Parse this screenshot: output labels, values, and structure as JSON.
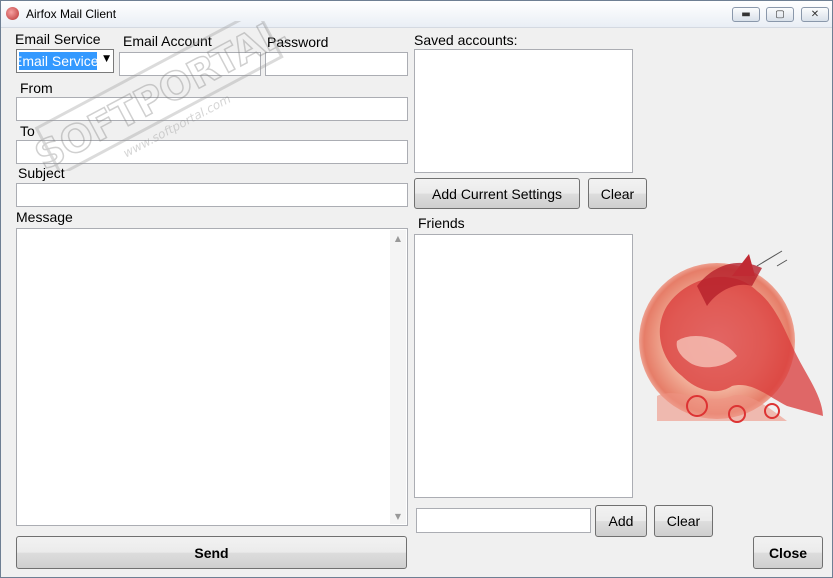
{
  "window": {
    "title": "Airfox Mail Client",
    "controls": {
      "minimize": "▬",
      "maximize": "▢",
      "close": "✕"
    }
  },
  "form": {
    "email_service_label": "Email Service",
    "email_service_selected": "Email Service",
    "email_account_label": "Email Account",
    "password_label": "Password",
    "from_label": "From",
    "to_label": "To",
    "subject_label": "Subject",
    "message_label": "Message",
    "send_button": "Send"
  },
  "saved_accounts": {
    "label": "Saved accounts:",
    "add_button": "Add Current Settings",
    "clear_button": "Clear"
  },
  "friends": {
    "label": "Friends",
    "add_button": "Add",
    "clear_button": "Clear"
  },
  "close_button": "Close",
  "watermark": {
    "brand": "SOFTPORTAL",
    "url": "www.softportal.com",
    "tm": "™"
  }
}
